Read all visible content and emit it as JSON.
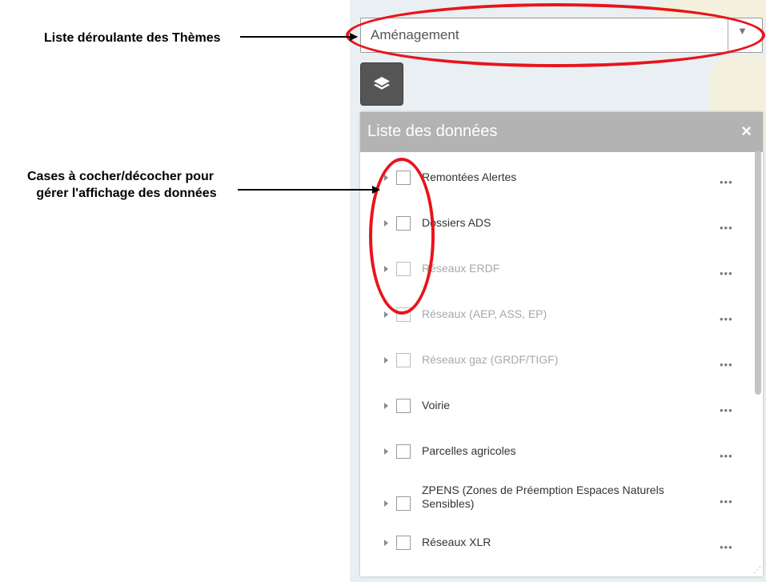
{
  "annotations": {
    "themes_label": "Liste déroulante  des Thèmes",
    "checkbox_label_line1": "Cases à cocher/décocher pour",
    "checkbox_label_line2": "gérer l'affichage des données"
  },
  "theme_dropdown": {
    "selected": "Aménagement"
  },
  "panel": {
    "title": "Liste des données",
    "close": "×",
    "items": [
      {
        "label": "Remontées Alertes",
        "enabled": true,
        "more": "•••"
      },
      {
        "label": "Dossiers ADS",
        "enabled": true,
        "more": "•••"
      },
      {
        "label": "Réseaux ERDF",
        "enabled": false,
        "more": "•••"
      },
      {
        "label": "Réseaux (AEP, ASS, EP)",
        "enabled": false,
        "more": "•••"
      },
      {
        "label": "Réseaux gaz (GRDF/TIGF)",
        "enabled": false,
        "more": "•••"
      },
      {
        "label": "Voirie",
        "enabled": true,
        "more": "•••"
      },
      {
        "label": "Parcelles agricoles",
        "enabled": true,
        "more": "•••"
      },
      {
        "label": "ZPENS (Zones de Préemption Espaces Naturels Sensibles)",
        "enabled": true,
        "more": "•••"
      },
      {
        "label": "Réseaux XLR",
        "enabled": true,
        "more": "•••"
      }
    ]
  },
  "icons": {
    "layers": "layers-icon",
    "caret": "chevron-down-icon",
    "expander": "caret-right-icon"
  },
  "colors": {
    "highlight": "#e8141c",
    "header": "#b3b3b3",
    "layers_button": "#555555"
  }
}
